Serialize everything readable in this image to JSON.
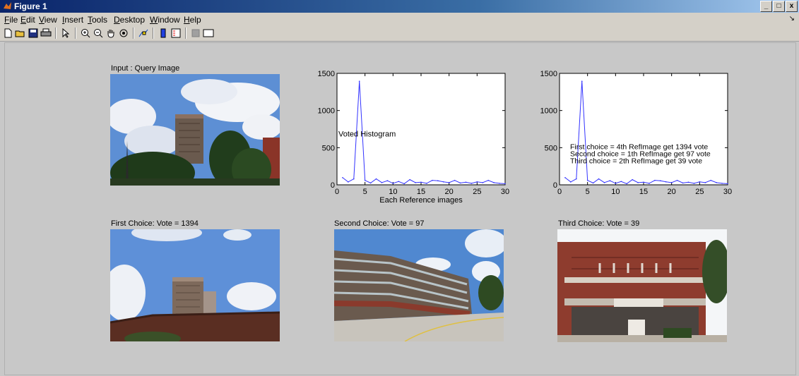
{
  "window": {
    "title": "Figure 1",
    "min": "_",
    "max": "□",
    "close": "x"
  },
  "menu": [
    "File",
    "Edit",
    "View",
    "Insert",
    "Tools",
    "Desktop",
    "Window",
    "Help"
  ],
  "toolbar_icons": [
    "new-figure-icon",
    "open-file-icon",
    "save-icon",
    "print-icon",
    "edit-plot-arrow-icon",
    "zoom-in-icon",
    "zoom-out-icon",
    "pan-hand-icon",
    "rotate-3d-icon",
    "data-cursor-icon",
    "colorbar-icon",
    "legend-icon",
    "hide-plot-tools-icon",
    "show-plot-tools-icon"
  ],
  "panels": {
    "query_title": "Input : Query Image",
    "first_title": "First Choice: Vote = 1394",
    "second_title": "Second Choice: Vote = 97",
    "third_title": "Third Choice: Vote = 39"
  },
  "chart_data": [
    {
      "type": "line",
      "xlabel": "Each Reference images",
      "annotation": "Voted Histogram",
      "xlim": [
        0,
        30
      ],
      "ylim": [
        0,
        1500
      ],
      "xticks": [
        0,
        5,
        10,
        15,
        20,
        25,
        30
      ],
      "yticks": [
        0,
        500,
        1000,
        1500
      ],
      "x": [
        1,
        2,
        3,
        4,
        5,
        6,
        7,
        8,
        9,
        10,
        11,
        12,
        13,
        14,
        15,
        16,
        17,
        18,
        19,
        20,
        21,
        22,
        23,
        24,
        25,
        26,
        27,
        28,
        29,
        30
      ],
      "y": [
        97,
        39,
        80,
        1394,
        60,
        25,
        80,
        30,
        55,
        20,
        45,
        15,
        70,
        30,
        35,
        20,
        60,
        55,
        40,
        30,
        60,
        25,
        35,
        20,
        40,
        30,
        60,
        30,
        20,
        15
      ],
      "color": "#3333ff"
    },
    {
      "type": "line",
      "xlabel": "",
      "annotations": [
        "First choice = 4th RefImage get 1394 vote",
        "Second choice = 1th RefImage get 97 vote",
        "Third choice = 2th RefImage get 39 vote"
      ],
      "xlim": [
        0,
        30
      ],
      "ylim": [
        0,
        1500
      ],
      "xticks": [
        0,
        5,
        10,
        15,
        20,
        25,
        30
      ],
      "yticks": [
        0,
        500,
        1000,
        1500
      ],
      "x": [
        1,
        2,
        3,
        4,
        5,
        6,
        7,
        8,
        9,
        10,
        11,
        12,
        13,
        14,
        15,
        16,
        17,
        18,
        19,
        20,
        21,
        22,
        23,
        24,
        25,
        26,
        27,
        28,
        29,
        30
      ],
      "y": [
        97,
        39,
        80,
        1394,
        60,
        25,
        80,
        30,
        55,
        20,
        45,
        15,
        70,
        30,
        35,
        20,
        60,
        55,
        40,
        30,
        60,
        25,
        35,
        20,
        40,
        30,
        60,
        30,
        20,
        15
      ],
      "color": "#3333ff"
    }
  ]
}
